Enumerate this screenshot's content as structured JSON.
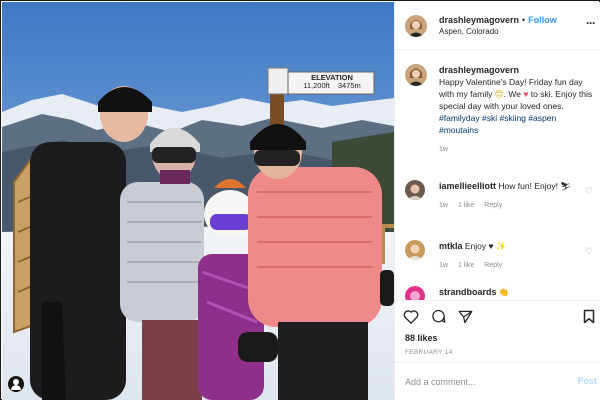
{
  "header": {
    "username": "drashleymagovern",
    "separator": "•",
    "follow_label": "Follow",
    "location": "Aspen, Colorado",
    "more_icon": "more-horizontal-icon"
  },
  "photo": {
    "sign_line1": "ELEVATION",
    "sign_line2": "11,200ft",
    "sign_line3": "3475m",
    "user_tag_icon": "user-tag-icon"
  },
  "caption": {
    "username": "drashleymagovern",
    "text_part1": "Happy Valentine's Day! Friday fun day with my family",
    "smile_emoji": "😊",
    "text_part2": ". We",
    "heart_emoji": "♥",
    "text_part3": "to ski. Enjoy this special day with your loved ones.",
    "hashtags": "#familyday #ski #skiing #aspen #moutains",
    "time": "1w"
  },
  "comments": [
    {
      "username": "iamellieelliott",
      "text": "How fun! Enjoy! ⛷",
      "time": "1w",
      "likes": "1 like",
      "reply": "Reply"
    },
    {
      "username": "mtkla",
      "text": "Enjoy ♥ ✨",
      "time": "1w",
      "likes": "1 like",
      "reply": "Reply"
    },
    {
      "username": "strandboards",
      "text": "👏"
    }
  ],
  "actions": {
    "like_icon": "heart-icon",
    "comment_icon": "comment-icon",
    "share_icon": "share-icon",
    "save_icon": "bookmark-icon"
  },
  "likes_count": "88 likes",
  "date": "FEBRUARY 14",
  "add_comment": {
    "placeholder": "Add a comment...",
    "post_label": "Post"
  },
  "colors": {
    "follow": "#3897f0",
    "hashtag": "#00376b",
    "heart": "#ed4956",
    "muted": "#8e8e8e",
    "sky": "#6fa2d8"
  }
}
